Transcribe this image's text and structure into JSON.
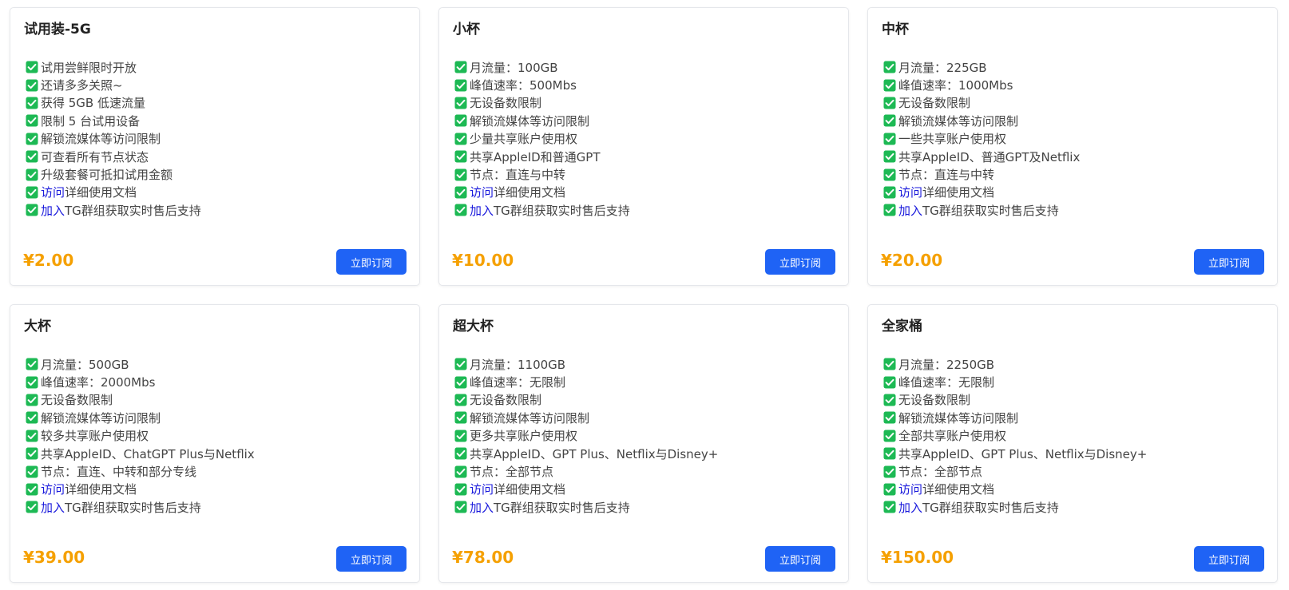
{
  "theme": {
    "accent": "#1f63f5",
    "price_color": "#f5a000",
    "check_color": "#1db954",
    "link_color": "#1a1adc"
  },
  "plans": [
    {
      "title": "试用装-5G",
      "features": [
        {
          "text": "试用尝鲜限时开放"
        },
        {
          "text": "还请多多关照~"
        },
        {
          "text": "获得 5GB 低速流量"
        },
        {
          "text": "限制 5 台试用设备"
        },
        {
          "text": "解锁流媒体等访问限制"
        },
        {
          "text": "可查看所有节点状态"
        },
        {
          "text": "升级套餐可抵扣试用金额"
        },
        {
          "link": "访问",
          "text": "详细使用文档"
        },
        {
          "link": "加入",
          "text": "TG群组获取实时售后支持"
        }
      ],
      "price": "¥2.00",
      "button": "立即订阅"
    },
    {
      "title": "小杯",
      "features": [
        {
          "text": "月流量：100GB"
        },
        {
          "text": "峰值速率：500Mbs"
        },
        {
          "text": "无设备数限制"
        },
        {
          "text": "解锁流媒体等访问限制"
        },
        {
          "text": "少量共享账户使用权"
        },
        {
          "text": "共享AppleID和普通GPT"
        },
        {
          "text": "节点：直连与中转"
        },
        {
          "link": "访问",
          "text": "详细使用文档"
        },
        {
          "link": "加入",
          "text": "TG群组获取实时售后支持"
        }
      ],
      "price": "¥10.00",
      "button": "立即订阅"
    },
    {
      "title": "中杯",
      "features": [
        {
          "text": "月流量：225GB"
        },
        {
          "text": "峰值速率：1000Mbs"
        },
        {
          "text": "无设备数限制"
        },
        {
          "text": "解锁流媒体等访问限制"
        },
        {
          "text": "一些共享账户使用权"
        },
        {
          "text": "共享AppleID、普通GPT及Netflix"
        },
        {
          "text": "节点：直连与中转"
        },
        {
          "link": "访问",
          "text": "详细使用文档"
        },
        {
          "link": "加入",
          "text": "TG群组获取实时售后支持"
        }
      ],
      "price": "¥20.00",
      "button": "立即订阅"
    },
    {
      "title": "大杯",
      "features": [
        {
          "text": "月流量：500GB"
        },
        {
          "text": "峰值速率：2000Mbs"
        },
        {
          "text": "无设备数限制"
        },
        {
          "text": "解锁流媒体等访问限制"
        },
        {
          "text": "较多共享账户使用权"
        },
        {
          "text": "共享AppleID、ChatGPT Plus与Netflix"
        },
        {
          "text": "节点：直连、中转和部分专线"
        },
        {
          "link": "访问",
          "text": "详细使用文档"
        },
        {
          "link": "加入",
          "text": "TG群组获取实时售后支持"
        }
      ],
      "price": "¥39.00",
      "button": "立即订阅"
    },
    {
      "title": "超大杯",
      "features": [
        {
          "text": "月流量：1100GB"
        },
        {
          "text": "峰值速率：无限制"
        },
        {
          "text": "无设备数限制"
        },
        {
          "text": "解锁流媒体等访问限制"
        },
        {
          "text": "更多共享账户使用权"
        },
        {
          "text": "共享AppleID、GPT Plus、Netflix与Disney+"
        },
        {
          "text": "节点：全部节点"
        },
        {
          "link": "访问",
          "text": "详细使用文档"
        },
        {
          "link": "加入",
          "text": "TG群组获取实时售后支持"
        }
      ],
      "price": "¥78.00",
      "button": "立即订阅"
    },
    {
      "title": "全家桶",
      "features": [
        {
          "text": "月流量：2250GB"
        },
        {
          "text": "峰值速率：无限制"
        },
        {
          "text": "无设备数限制"
        },
        {
          "text": "解锁流媒体等访问限制"
        },
        {
          "text": "全部共享账户使用权"
        },
        {
          "text": "共享AppleID、GPT Plus、Netflix与Disney+"
        },
        {
          "text": "节点：全部节点"
        },
        {
          "link": "访问",
          "text": "详细使用文档"
        },
        {
          "link": "加入",
          "text": "TG群组获取实时售后支持"
        }
      ],
      "price": "¥150.00",
      "button": "立即订阅"
    }
  ]
}
